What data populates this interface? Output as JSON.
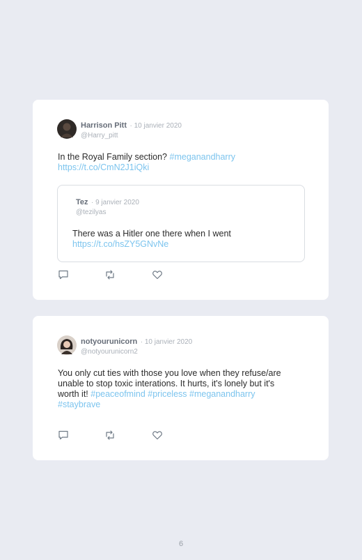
{
  "tweets": [
    {
      "author": "Harrison Pitt",
      "date": "· 10 janvier 2020",
      "handle": "@Harry_pitt",
      "text": "In the Royal Family section?",
      "hashtag": "#meganandharry",
      "link": "https://t.co/CmN2J1iQki",
      "quoted": {
        "author": "Tez",
        "date": "· 9 janvier 2020",
        "handle": "@tezilyas",
        "text": "There was a Hitler one there when I went",
        "link": "https://t.co/hsZY5GNvNe"
      }
    },
    {
      "author": "notyourunicorn",
      "date": "· 10 janvier 2020",
      "handle": "@notyourunicorn2",
      "text_line1": "You only cut ties with those you love when they refuse/are",
      "text_line2": "unable to stop toxic interations. It hurts, it's lonely but it's",
      "text_line3": "worth it!",
      "hashtags_line3": "#peaceofmind #priceless #meganandharry",
      "hashtag_line4": "#staybrave"
    }
  ],
  "icons": {
    "reply": "reply-icon",
    "retweet": "retweet-icon",
    "like": "heart-icon"
  },
  "page_number": "6",
  "colors": {
    "background": "#e9ebf2",
    "card": "#ffffff",
    "link": "#7cc4ee",
    "meta": "#aab0b8",
    "icon": "#6f7a86"
  }
}
